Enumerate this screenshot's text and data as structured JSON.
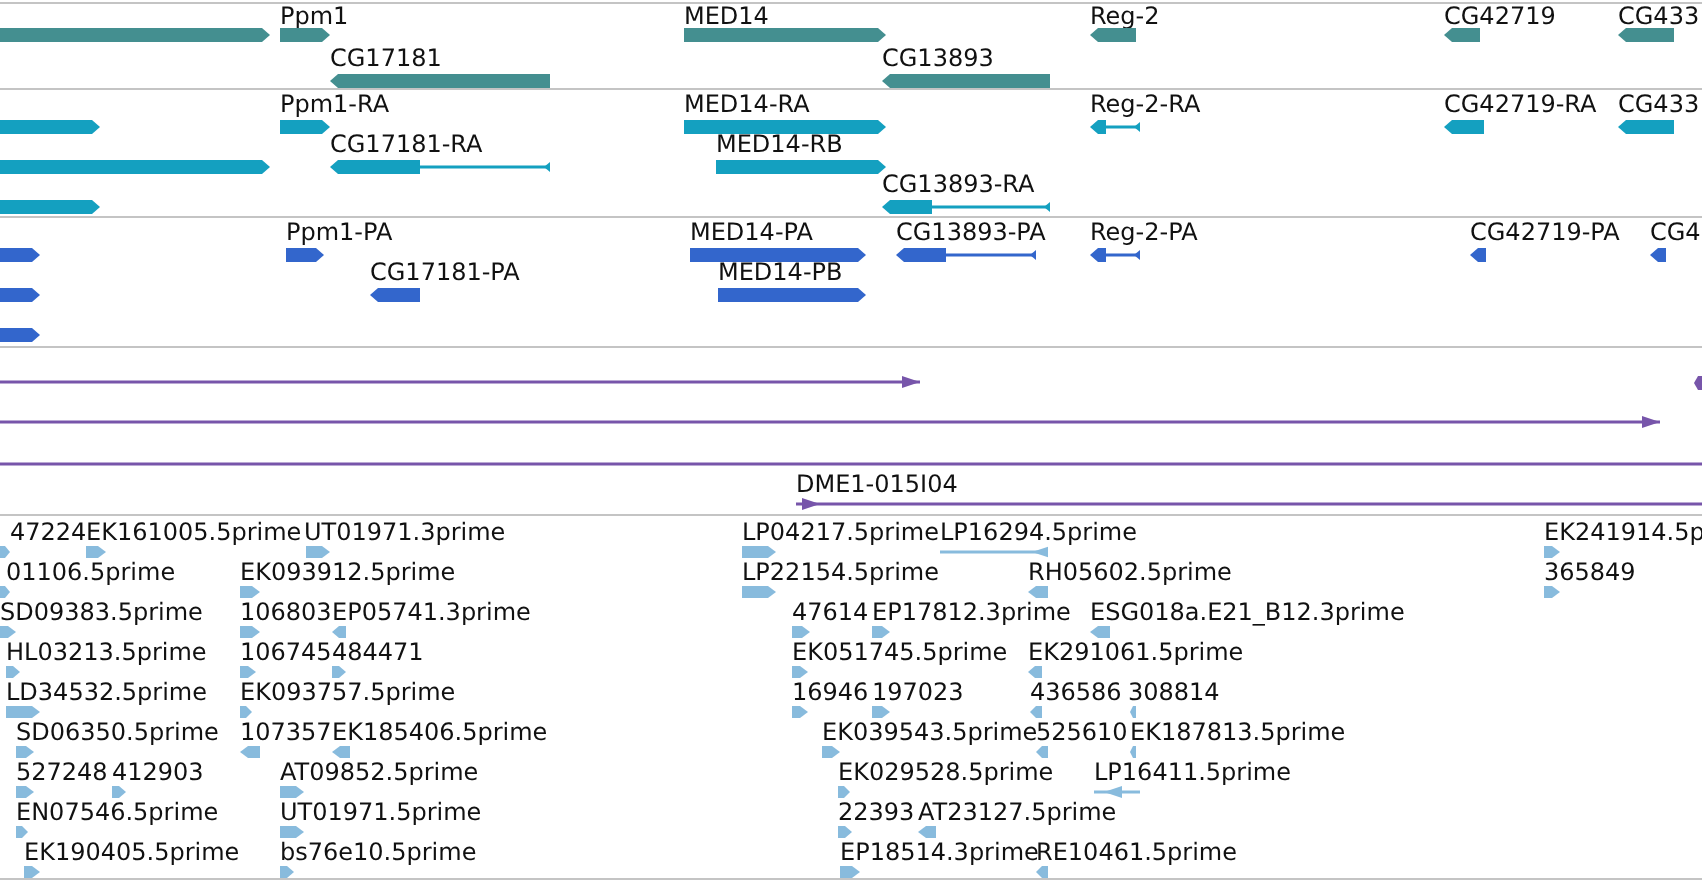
{
  "tracks": [
    {
      "kind": "gene",
      "features": [
        {
          "reverse": false
        },
        {
          "label": "Ppm1",
          "reverse": false
        },
        {
          "label": "CG17181",
          "reverse": true
        },
        {
          "label": "MED14",
          "reverse": false
        },
        {
          "label": "CG13893",
          "reverse": true
        },
        {
          "label": "Reg-2",
          "reverse": true
        },
        {
          "label": "CG42719",
          "reverse": true
        },
        {
          "label": "CG433",
          "reverse": true
        }
      ]
    },
    {
      "kind": "mrna",
      "features": [
        {
          "reverse": false
        },
        {
          "reverse": false
        },
        {
          "reverse": false
        },
        {
          "label": "Ppm1-RA",
          "reverse": false
        },
        {
          "label": "CG17181-RA",
          "reverse": true
        },
        {
          "label": "MED14-RA",
          "reverse": false
        },
        {
          "label": "MED14-RB",
          "reverse": false
        },
        {
          "label": "CG13893-RA",
          "reverse": true
        },
        {
          "label": "Reg-2-RA",
          "reverse": true
        },
        {
          "label": "CG42719-RA",
          "reverse": true
        },
        {
          "label": "CG433",
          "reverse": true
        }
      ]
    },
    {
      "kind": "polypeptide",
      "features": [
        {
          "reverse": false
        },
        {
          "reverse": false
        },
        {
          "reverse": false
        },
        {
          "label": "Ppm1-PA",
          "reverse": false
        },
        {
          "label": "CG17181-PA",
          "reverse": true
        },
        {
          "label": "MED14-PA",
          "reverse": false
        },
        {
          "label": "MED14-PB",
          "reverse": false
        },
        {
          "label": "CG13893-PA",
          "reverse": true
        },
        {
          "label": "Reg-2-PA",
          "reverse": true
        },
        {
          "label": "CG42719-PA",
          "reverse": true
        },
        {
          "label": "CG4",
          "reverse": true
        }
      ]
    },
    {
      "kind": "clone",
      "features": [
        {
          "reverse": false
        },
        {
          "reverse": false
        },
        {
          "reverse": true
        },
        {
          "reverse": false
        },
        {
          "label": "DME1-015I04",
          "reverse": false
        }
      ]
    },
    {
      "kind": "est",
      "features": [
        {
          "label": "47224",
          "reverse": false
        },
        {
          "label": "EK161005.5prime",
          "reverse": false
        },
        {
          "label": "UT01971.3prime",
          "reverse": false
        },
        {
          "label": "LP04217.5prime",
          "reverse": false
        },
        {
          "label": "LP16294.5prime",
          "reverse": true
        },
        {
          "label": "EK241914.5p",
          "reverse": false
        },
        {
          "label": "01106.5prime",
          "reverse": false
        },
        {
          "label": "EK093912.5prime",
          "reverse": false
        },
        {
          "label": "LP22154.5prime",
          "reverse": false
        },
        {
          "label": "RH05602.5prime",
          "reverse": true
        },
        {
          "label": "365849",
          "reverse": false
        },
        {
          "label": "SD09383.5prime",
          "reverse": false
        },
        {
          "label": "106803",
          "reverse": false
        },
        {
          "label": "EP05741.3prime",
          "reverse": true
        },
        {
          "label": "47614",
          "reverse": false
        },
        {
          "label": "EP17812.3prime",
          "reverse": false
        },
        {
          "label": "ESG018a.E21_B12.3prime",
          "reverse": true
        },
        {
          "label": "HL03213.5prime",
          "reverse": false
        },
        {
          "label": "106745",
          "reverse": false
        },
        {
          "label": "484471",
          "reverse": false
        },
        {
          "label": "EK051745.5prime",
          "reverse": false
        },
        {
          "label": "EK291061.5prime",
          "reverse": true
        },
        {
          "label": "LD34532.5prime",
          "reverse": false
        },
        {
          "label": "EK093757.5prime",
          "reverse": false
        },
        {
          "label": "16946",
          "reverse": false
        },
        {
          "label": "197023",
          "reverse": false
        },
        {
          "label": "436586",
          "reverse": true
        },
        {
          "label": "308814",
          "reverse": true
        },
        {
          "label": "SD06350.5prime",
          "reverse": false
        },
        {
          "label": "107357",
          "reverse": true
        },
        {
          "label": "EK185406.5prime",
          "reverse": true
        },
        {
          "label": "EK039543.5prime",
          "reverse": false
        },
        {
          "label": "525610",
          "reverse": true
        },
        {
          "label": "EK187813.5prime",
          "reverse": true
        },
        {
          "label": "527248",
          "reverse": false
        },
        {
          "label": "412903",
          "reverse": false
        },
        {
          "label": "AT09852.5prime",
          "reverse": false
        },
        {
          "label": "EK029528.5prime",
          "reverse": false
        },
        {
          "label": "LP16411.5prime",
          "reverse": true
        },
        {
          "label": "EN07546.5prime",
          "reverse": false
        },
        {
          "label": "UT01971.5prime",
          "reverse": false
        },
        {
          "label": "22393",
          "reverse": false
        },
        {
          "label": "AT23127.5prime",
          "reverse": true
        },
        {
          "label": "EK190405.5prime",
          "reverse": false
        },
        {
          "label": "bs76e10.5prime",
          "reverse": false
        },
        {
          "label": "EP18514.3prime",
          "reverse": false
        },
        {
          "label": "RE10461.5prime",
          "reverse": true
        }
      ]
    }
  ]
}
